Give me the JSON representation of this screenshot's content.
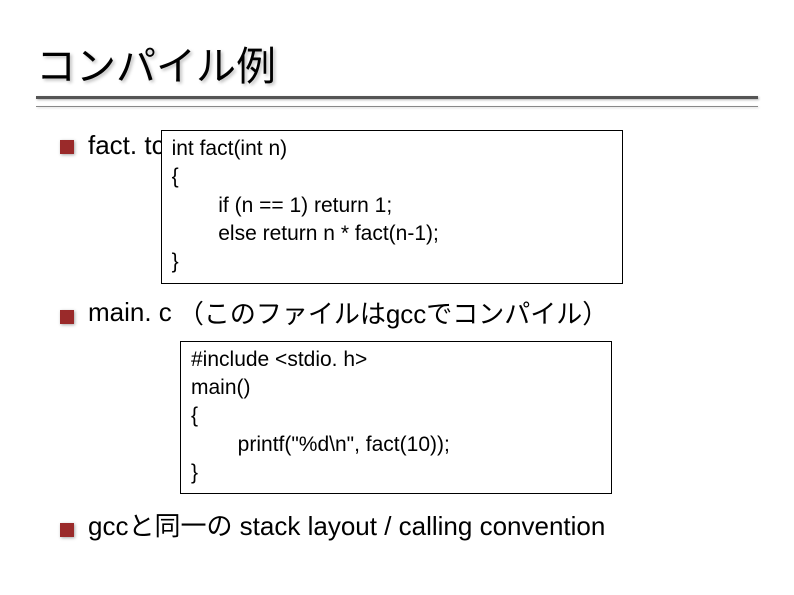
{
  "title": "コンパイル例",
  "items": [
    {
      "label": "fact. tc",
      "code": "int fact(int n)\n{\n        if (n == 1) return 1;\n        else return n * fact(n-1);\n}"
    },
    {
      "label": "main. c",
      "suffix": "（このファイルはgccでコンパイル）",
      "code": "#include <stdio. h>\nmain()\n{\n        printf(\"%d\\n\", fact(10));\n}"
    },
    {
      "label": "gccと同一の stack layout / calling convention"
    }
  ]
}
